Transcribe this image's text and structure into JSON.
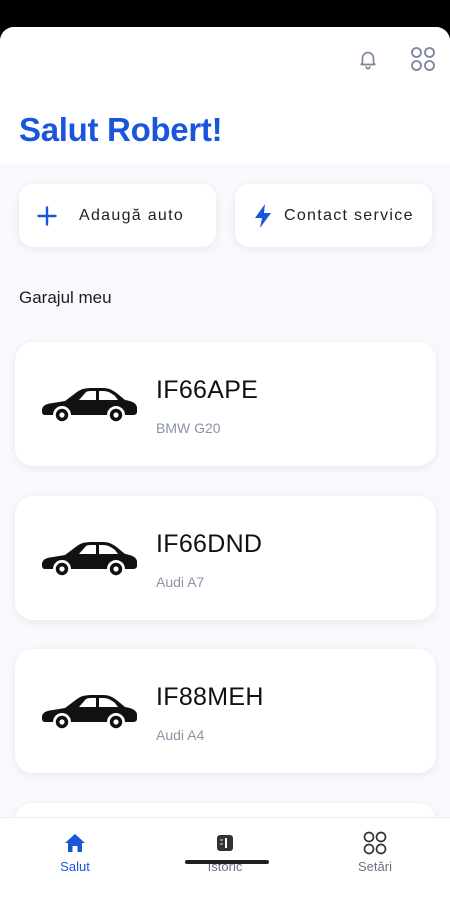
{
  "header": {
    "greeting": "Salut Robert!",
    "icons": [
      "bell-icon",
      "apps-grid-icon"
    ]
  },
  "actions": [
    {
      "label": "Adaugă auto",
      "icon": "plus-icon"
    },
    {
      "label": "Contact service",
      "icon": "lightning-icon"
    }
  ],
  "garage": {
    "title": "Garajul meu",
    "cars": [
      {
        "plate": "IF66APE",
        "model": "BMW G20"
      },
      {
        "plate": "IF66DND",
        "model": "Audi A7"
      },
      {
        "plate": "IF88MEH",
        "model": "Audi A4"
      }
    ]
  },
  "nav": {
    "items": [
      {
        "label": "Salut",
        "icon": "home-icon",
        "active": true
      },
      {
        "label": "Istoric",
        "icon": "history-icon",
        "active": false
      },
      {
        "label": "Setări",
        "icon": "settings-grid-icon",
        "active": false
      }
    ]
  },
  "colors": {
    "accent": "#1a56db",
    "background": "#f7f9fc",
    "muted": "#8a94a6"
  }
}
